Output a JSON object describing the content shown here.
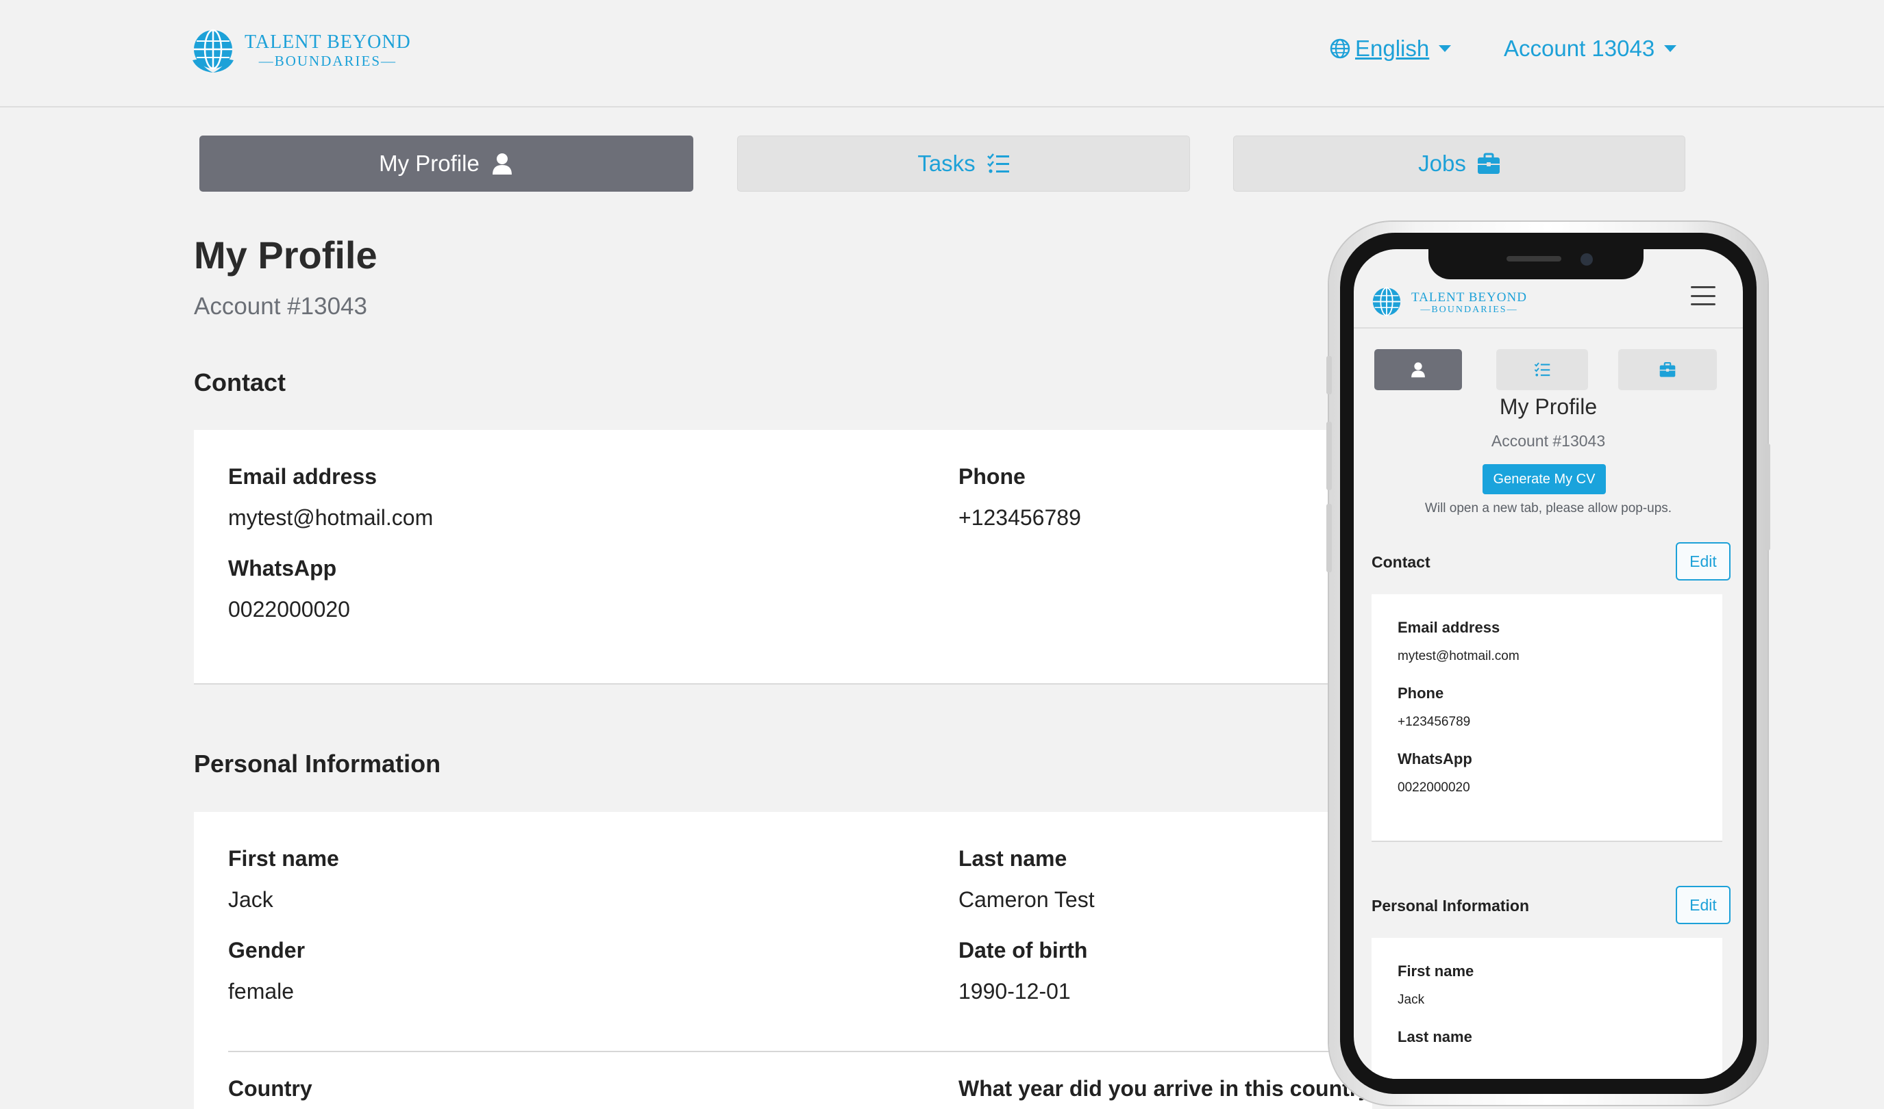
{
  "header": {
    "logo": {
      "line1": "TALENT BEYOND",
      "line2": "—BOUNDARIES—"
    },
    "language": {
      "label": "English",
      "icon": "globe-icon"
    },
    "account_menu": {
      "label": "Account 13043"
    }
  },
  "tabs": [
    {
      "label": "My Profile",
      "icon": "user-icon",
      "active": true
    },
    {
      "label": "Tasks",
      "icon": "checklist-icon",
      "active": false
    },
    {
      "label": "Jobs",
      "icon": "briefcase-icon",
      "active": false
    }
  ],
  "profile": {
    "title": "My Profile",
    "account_number": "Account #13043"
  },
  "contact": {
    "title": "Contact",
    "fields": {
      "email": {
        "label": "Email address",
        "value": "mytest@hotmail.com"
      },
      "phone": {
        "label": "Phone",
        "value": "+123456789"
      },
      "whatsapp": {
        "label": "WhatsApp",
        "value": "0022000020"
      }
    }
  },
  "personal": {
    "title": "Personal Information",
    "fields": {
      "first_name": {
        "label": "First name",
        "value": "Jack"
      },
      "last_name": {
        "label": "Last name",
        "value": "Cameron Test"
      },
      "gender": {
        "label": "Gender",
        "value": "female"
      },
      "dob": {
        "label": "Date of birth",
        "value": "1990-12-01"
      },
      "country": {
        "label": "Country"
      },
      "arrival_year": {
        "label": "What year did you arrive in this country?"
      }
    }
  },
  "mobile": {
    "logo": {
      "line1": "TALENT BEYOND",
      "line2": "—BOUNDARIES—"
    },
    "title": "My Profile",
    "account_number": "Account #13043",
    "generate_cv_label": "Generate My CV",
    "generate_cv_note": "Will open a new tab, please allow pop-ups.",
    "contact_title": "Contact",
    "edit_label": "Edit",
    "email_label": "Email address",
    "email_value": "mytest@hotmail.com",
    "phone_label": "Phone",
    "phone_value": "+123456789",
    "whatsapp_label": "WhatsApp",
    "whatsapp_value": "0022000020",
    "personal_title": "Personal Information",
    "first_name_label": "First name",
    "first_name_value": "Jack",
    "last_name_label": "Last name"
  },
  "colors": {
    "accent": "#1da1d8",
    "active_tab": "#6d6f78",
    "page_bg": "#f2f2f2",
    "card_bg": "#ffffff"
  }
}
